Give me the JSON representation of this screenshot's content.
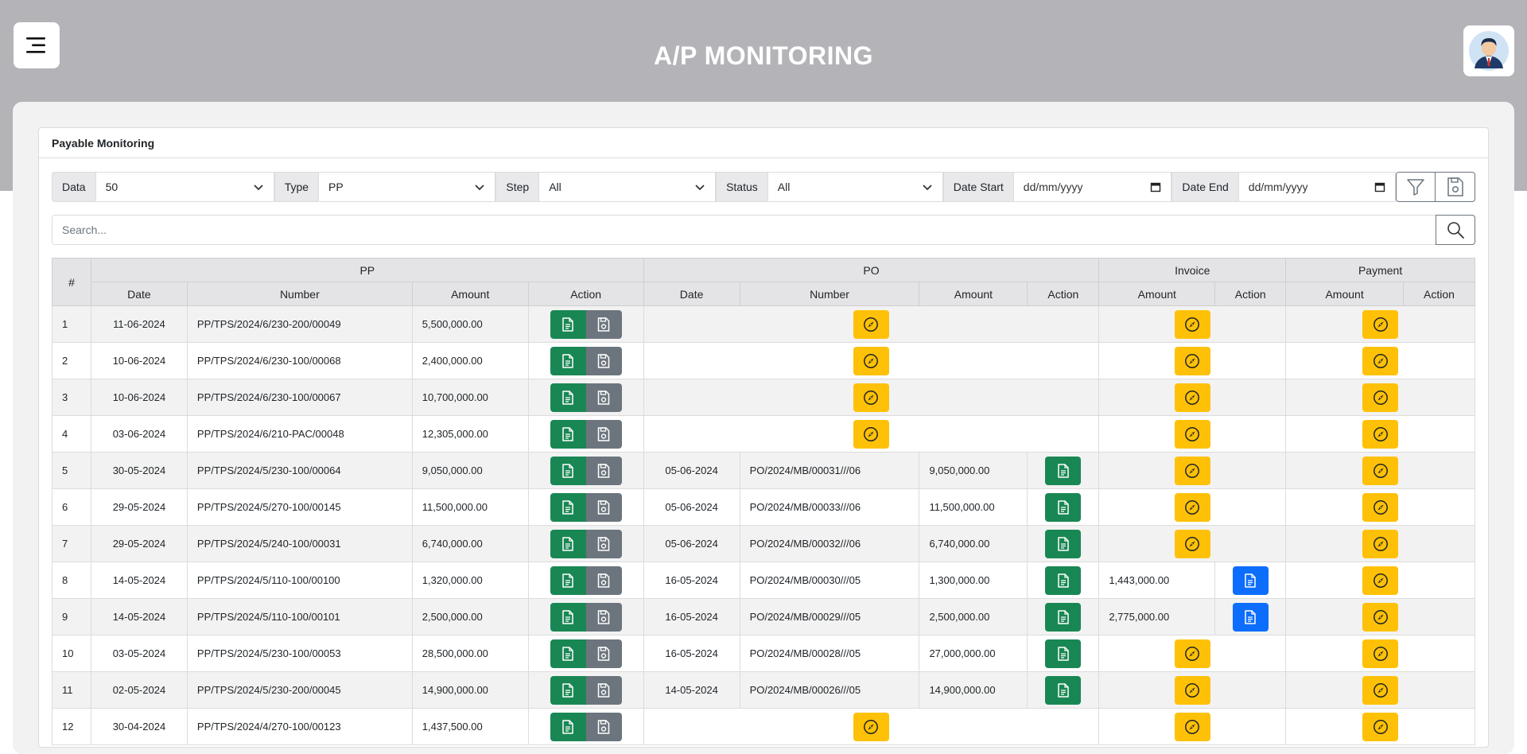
{
  "header": {
    "title": "A/P MONITORING"
  },
  "card": {
    "title": "Payable Monitoring"
  },
  "filters": {
    "data": {
      "label": "Data",
      "value": "50"
    },
    "type": {
      "label": "Type",
      "value": "PP"
    },
    "step": {
      "label": "Step",
      "value": "All"
    },
    "status": {
      "label": "Status",
      "value": "All"
    },
    "date_start": {
      "label": "Date Start",
      "placeholder": "dd/mm/yyyy"
    },
    "date_end": {
      "label": "Date End",
      "placeholder": "dd/mm/yyyy"
    }
  },
  "search": {
    "placeholder": "Search..."
  },
  "table": {
    "groups": {
      "num": "#",
      "pp": "PP",
      "po": "PO",
      "invoice": "Invoice",
      "payment": "Payment"
    },
    "cols": {
      "pp_date": "Date",
      "pp_number": "Number",
      "pp_amount": "Amount",
      "pp_action": "Action",
      "po_date": "Date",
      "po_number": "Number",
      "po_amount": "Amount",
      "po_action": "Action",
      "inv_amount": "Amount",
      "inv_action": "Action",
      "pay_amount": "Amount",
      "pay_action": "Action"
    },
    "rows": [
      {
        "no": "1",
        "pp_date": "11-06-2024",
        "pp_number": "PP/TPS/2024/6/230-200/00049",
        "pp_amount": "5,500,000.00",
        "po": null,
        "invoice": null
      },
      {
        "no": "2",
        "pp_date": "10-06-2024",
        "pp_number": "PP/TPS/2024/6/230-100/00068",
        "pp_amount": "2,400,000.00",
        "po": null,
        "invoice": null
      },
      {
        "no": "3",
        "pp_date": "10-06-2024",
        "pp_number": "PP/TPS/2024/6/230-100/00067",
        "pp_amount": "10,700,000.00",
        "po": null,
        "invoice": null
      },
      {
        "no": "4",
        "pp_date": "03-06-2024",
        "pp_number": "PP/TPS/2024/6/210-PAC/00048",
        "pp_amount": "12,305,000.00",
        "po": null,
        "invoice": null
      },
      {
        "no": "5",
        "pp_date": "30-05-2024",
        "pp_number": "PP/TPS/2024/5/230-100/00064",
        "pp_amount": "9,050,000.00",
        "po": {
          "date": "05-06-2024",
          "number": "PO/2024/MB/00031///06",
          "amount": "9,050,000.00"
        },
        "invoice": null
      },
      {
        "no": "6",
        "pp_date": "29-05-2024",
        "pp_number": "PP/TPS/2024/5/270-100/00145",
        "pp_amount": "11,500,000.00",
        "po": {
          "date": "05-06-2024",
          "number": "PO/2024/MB/00033///06",
          "amount": "11,500,000.00"
        },
        "invoice": null
      },
      {
        "no": "7",
        "pp_date": "29-05-2024",
        "pp_number": "PP/TPS/2024/5/240-100/00031",
        "pp_amount": "6,740,000.00",
        "po": {
          "date": "05-06-2024",
          "number": "PO/2024/MB/00032///06",
          "amount": "6,740,000.00"
        },
        "invoice": null
      },
      {
        "no": "8",
        "pp_date": "14-05-2024",
        "pp_number": "PP/TPS/2024/5/110-100/00100",
        "pp_amount": "1,320,000.00",
        "po": {
          "date": "16-05-2024",
          "number": "PO/2024/MB/00030///05",
          "amount": "1,300,000.00"
        },
        "invoice": {
          "amount": "1,443,000.00"
        }
      },
      {
        "no": "9",
        "pp_date": "14-05-2024",
        "pp_number": "PP/TPS/2024/5/110-100/00101",
        "pp_amount": "2,500,000.00",
        "po": {
          "date": "16-05-2024",
          "number": "PO/2024/MB/00029///05",
          "amount": "2,500,000.00"
        },
        "invoice": {
          "amount": "2,775,000.00"
        }
      },
      {
        "no": "10",
        "pp_date": "03-05-2024",
        "pp_number": "PP/TPS/2024/5/230-100/00053",
        "pp_amount": "28,500,000.00",
        "po": {
          "date": "16-05-2024",
          "number": "PO/2024/MB/00028///05",
          "amount": "27,000,000.00"
        },
        "invoice": null
      },
      {
        "no": "11",
        "pp_date": "02-05-2024",
        "pp_number": "PP/TPS/2024/5/230-200/00045",
        "pp_amount": "14,900,000.00",
        "po": {
          "date": "14-05-2024",
          "number": "PO/2024/MB/00026///05",
          "amount": "14,900,000.00"
        },
        "invoice": null
      },
      {
        "no": "12",
        "pp_date": "30-04-2024",
        "pp_number": "PP/TPS/2024/4/270-100/00123",
        "pp_amount": "1,437,500.00",
        "po": null,
        "invoice": null
      }
    ]
  },
  "icons": {
    "menu": "menu-icon",
    "avatar": "user-avatar",
    "filter": "filter-icon",
    "save": "save-icon",
    "search": "search-icon",
    "document": "document-icon",
    "compass": "compass-icon"
  },
  "colors": {
    "header_bg": "#b3b3b8",
    "green": "#198754",
    "gray": "#6c757d",
    "blue": "#0d6efd",
    "yellow": "#ffc107"
  }
}
